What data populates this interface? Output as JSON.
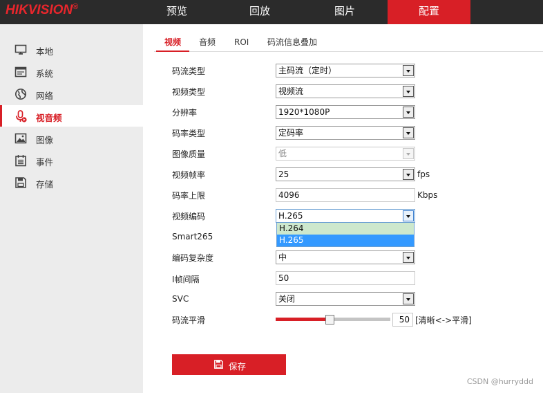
{
  "brand": {
    "name": "HIKVISION",
    "reg": "®"
  },
  "nav": [
    "预览",
    "回放",
    "图片",
    "配置"
  ],
  "sidebar": [
    {
      "label": "本地",
      "icon": "monitor-icon"
    },
    {
      "label": "系统",
      "icon": "system-window-icon"
    },
    {
      "label": "网络",
      "icon": "globe-icon"
    },
    {
      "label": "视音频",
      "icon": "microphone-icon",
      "active": true
    },
    {
      "label": "图像",
      "icon": "image-icon"
    },
    {
      "label": "事件",
      "icon": "calendar-icon"
    },
    {
      "label": "存储",
      "icon": "floppy-disk-icon"
    }
  ],
  "tabs": [
    "视频",
    "音频",
    "ROI",
    "码流信息叠加"
  ],
  "form": {
    "stream_type": {
      "label": "码流类型",
      "value": "主码流（定时）"
    },
    "video_type": {
      "label": "视频类型",
      "value": "视频流"
    },
    "resolution": {
      "label": "分辨率",
      "value": "1920*1080P"
    },
    "bitrate_type": {
      "label": "码率类型",
      "value": "定码率"
    },
    "image_quality": {
      "label": "图像质量",
      "value": "低"
    },
    "frame_rate": {
      "label": "视频帧率",
      "value": "25",
      "unit": "fps"
    },
    "max_bitrate": {
      "label": "码率上限",
      "value": "4096",
      "unit": "Kbps"
    },
    "video_encoding": {
      "label": "视频编码",
      "value": "H.265",
      "options": [
        "H.264",
        "H.265"
      ]
    },
    "smart265": {
      "label": "Smart265"
    },
    "encode_complexity": {
      "label": "编码复杂度",
      "value": "中"
    },
    "iframe_interval": {
      "label": "I帧间隔",
      "value": "50"
    },
    "svc": {
      "label": "SVC",
      "value": "关闭"
    },
    "stream_smoothing": {
      "label": "码流平滑",
      "value": "50",
      "fraction": 0.5,
      "hint": "[清晰<->平滑]"
    }
  },
  "save_label": "保存",
  "watermark": "CSDN @hurryddd",
  "colors": {
    "accent": "#d81f26",
    "topbar": "#2b2b2b",
    "sidebar": "#ececec",
    "option_hover": "#cde8cd",
    "option_selected": "#3399ff"
  }
}
